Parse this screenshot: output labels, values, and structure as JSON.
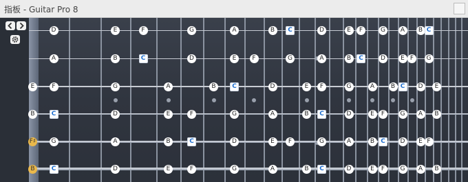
{
  "window": {
    "title": "指板 - Guitar Pro 8"
  },
  "sidebar": {
    "prev_icon": "chevron-left-icon",
    "next_icon": "chevron-right-icon",
    "settings_icon": "gear-icon"
  },
  "fretboard": {
    "strings": [
      {
        "open": "",
        "notes": [
          "D",
          "E",
          "F",
          "G",
          "A",
          "B",
          "C",
          "D",
          "E",
          "F",
          "G",
          "A",
          "B",
          "C"
        ]
      },
      {
        "open": "",
        "notes": [
          "A",
          "B",
          "C",
          "D",
          "E",
          "F",
          "G",
          "A",
          "B",
          "C",
          "D",
          "E",
          "F",
          "G"
        ]
      },
      {
        "open": "E",
        "notes": [
          "F",
          "G",
          "A",
          "B",
          "C",
          "D",
          "E",
          "F",
          "G",
          "A",
          "B",
          "C",
          "D",
          "E"
        ]
      },
      {
        "open": "B",
        "notes": [
          "C",
          "D",
          "E",
          "F",
          "G",
          "A",
          "B",
          "C",
          "D",
          "E",
          "F",
          "G",
          "A",
          "B"
        ]
      },
      {
        "open": "F♯",
        "notes": [
          "G",
          "A",
          "B",
          "C",
          "D",
          "E",
          "F",
          "G",
          "A",
          "B",
          "C",
          "D",
          "E",
          "F"
        ]
      },
      {
        "open": "B",
        "notes": [
          "C",
          "D",
          "E",
          "F",
          "G",
          "A",
          "B",
          "C",
          "D",
          "E",
          "F",
          "G",
          "A",
          "B"
        ]
      }
    ]
  }
}
